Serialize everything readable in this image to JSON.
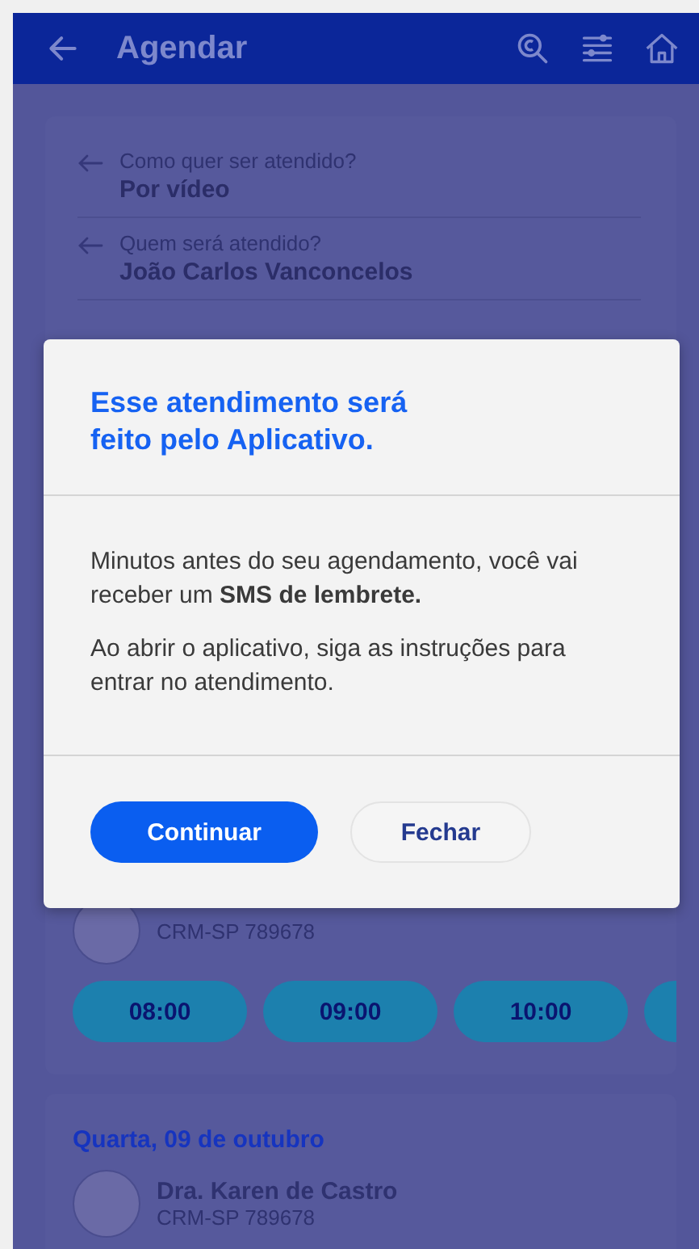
{
  "header": {
    "title": "Agendar"
  },
  "summary": [
    {
      "label": "Como quer ser atendido?",
      "value": "Por vídeo"
    },
    {
      "label": "Quem será atendido?",
      "value": "João Carlos Vanconcelos"
    }
  ],
  "days": [
    {
      "doctor": {
        "crm": "CRM-SP 789678"
      },
      "slots": [
        "08:00",
        "09:00",
        "10:00"
      ],
      "overflow": true
    },
    {
      "date": "Quarta, 09 de outubro",
      "doctor": {
        "name": "Dra. Karen de Castro",
        "crm": "CRM-SP 789678"
      }
    }
  ],
  "modal": {
    "title": "Esse atendimento será feito pelo Aplicativo.",
    "paragraphs": [
      "Minutos antes do seu agendamento, você vai receber um **SMS de lembrete.**",
      "Ao abrir o aplicativo, siga as instruções para entrar no atendimento."
    ],
    "buttons": [
      {
        "label": "Continuar",
        "kind": "primary"
      },
      {
        "label": "Fechar",
        "kind": "secondary"
      }
    ]
  }
}
